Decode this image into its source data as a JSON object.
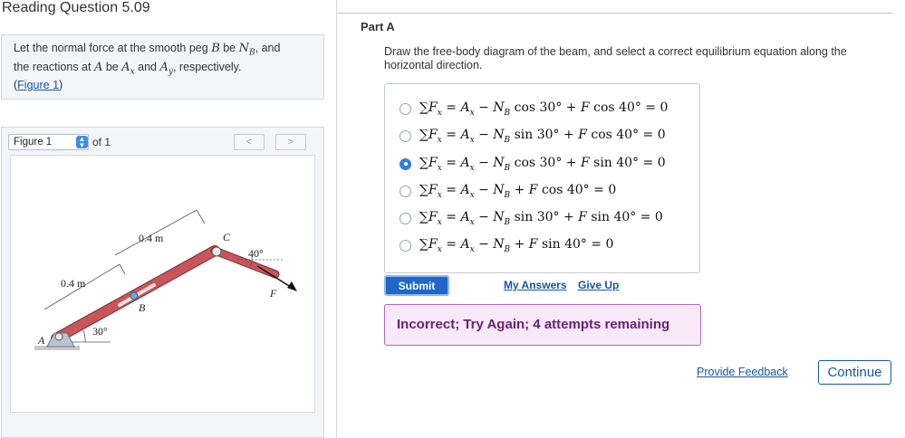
{
  "page": {
    "title": "Reading Question 5.09"
  },
  "intro": {
    "line1_pre": "Let the normal force at the smooth peg ",
    "line1_b": "B",
    "line1_mid": " be ",
    "line1_nb": "N",
    "line1_nb_sub": "B",
    "line1_post": ", and",
    "line2_pre": "the reactions at ",
    "line2_a": "A",
    "line2_be": " be ",
    "line2_ax": "A",
    "line2_ax_sub": "x",
    "line2_and": " and ",
    "line2_ay": "A",
    "line2_ay_sub": "y",
    "line2_post": ", respectively.",
    "figure_link_open": "(",
    "figure_link": "Figure 1",
    "figure_link_close": ")"
  },
  "figure_panel": {
    "selected": "Figure 1",
    "of_text": "of 1",
    "prev": "<",
    "next": ">",
    "labels": {
      "len_left": "0.4 m",
      "len_mid": "0.4 m",
      "angle_30": "30°",
      "angle_40": "40°",
      "point_a": "A",
      "point_b": "B",
      "point_c": "C",
      "force_f": "F"
    }
  },
  "part": {
    "label": "Part A",
    "question": "Draw the free-body diagram of the beam, and select a correct equilibrium equation along the horizontal direction."
  },
  "choices": [
    {
      "pre": "A",
      "term1": "N",
      "trig1": "cos",
      "ang1": "30°",
      "term2": "F",
      "trig2": "cos",
      "ang2": "40°",
      "selected": false
    },
    {
      "pre": "A",
      "term1": "N",
      "trig1": "sin",
      "ang1": "30°",
      "term2": "F",
      "trig2": "cos",
      "ang2": "40°",
      "selected": false
    },
    {
      "pre": "A",
      "term1": "N",
      "trig1": "cos",
      "ang1": "30°",
      "term2": "F",
      "trig2": "sin",
      "ang2": "40°",
      "selected": true
    },
    {
      "pre": "A",
      "term1": "N",
      "trig1": "",
      "ang1": "",
      "term2": "F",
      "trig2": "cos",
      "ang2": "40°",
      "selected": false
    },
    {
      "pre": "A",
      "term1": "N",
      "trig1": "sin",
      "ang1": "30°",
      "term2": "F",
      "trig2": "sin",
      "ang2": "40°",
      "selected": false
    },
    {
      "pre": "A",
      "term1": "N",
      "trig1": "",
      "ang1": "",
      "term2": "F",
      "trig2": "sin",
      "ang2": "40°",
      "selected": false
    }
  ],
  "actions": {
    "submit": "Submit",
    "my_answers": "My Answers",
    "give_up": "Give Up"
  },
  "feedback": {
    "message": "Incorrect; Try Again; 4 attempts remaining"
  },
  "footer": {
    "provide_feedback": "Provide Feedback",
    "continue": "Continue"
  },
  "colors": {
    "beam": "#c8555a",
    "link": "#1a57a6",
    "submit_bg": "#1f66c9",
    "feedback_bg": "#f7e9f8",
    "feedback_text": "#6a1f78"
  }
}
